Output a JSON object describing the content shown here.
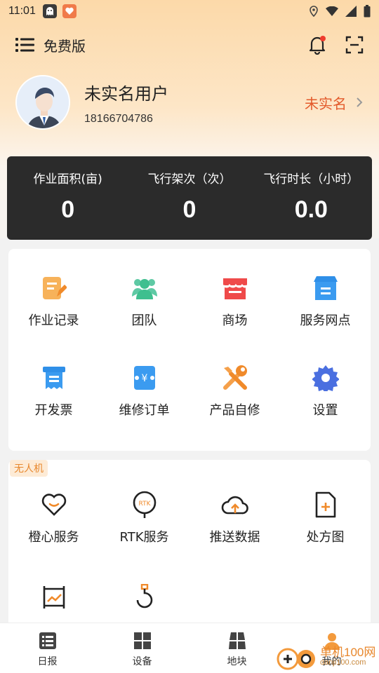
{
  "status_bar": {
    "time": "11:01",
    "icons": [
      "ghost-app-icon",
      "heart-app-icon",
      "location-icon",
      "wifi-icon",
      "signal-icon",
      "battery-icon"
    ]
  },
  "topbar": {
    "menu_icon": "list-icon",
    "edition": "免费版",
    "bell_icon": "bell-icon",
    "scan_icon": "scan-icon"
  },
  "profile": {
    "name": "未实名用户",
    "phone": "18166704786",
    "verify_label": "未实名"
  },
  "stats": [
    {
      "label": "作业面积(亩)",
      "value": "0"
    },
    {
      "label": "飞行架次（次）",
      "value": "0"
    },
    {
      "label": "飞行时长（小时）",
      "value": "0.0"
    }
  ],
  "services": [
    {
      "label": "作业记录",
      "icon": "note-edit-icon"
    },
    {
      "label": "团队",
      "icon": "team-icon"
    },
    {
      "label": "商场",
      "icon": "store-icon"
    },
    {
      "label": "服务网点",
      "icon": "service-point-icon"
    },
    {
      "label": "开发票",
      "icon": "invoice-icon"
    },
    {
      "label": "维修订单",
      "icon": "repair-order-icon"
    },
    {
      "label": "产品自修",
      "icon": "wrench-icon"
    },
    {
      "label": "设置",
      "icon": "gear-icon"
    }
  ],
  "drone": {
    "tag": "无人机",
    "items": [
      {
        "label": "橙心服务",
        "icon": "heart-smile-icon"
      },
      {
        "label": "RTK服务",
        "icon": "rtk-icon"
      },
      {
        "label": "推送数据",
        "icon": "cloud-upload-icon"
      },
      {
        "label": "处方图",
        "icon": "prescription-map-icon"
      },
      {
        "label": "",
        "icon": "chart-frame-icon"
      },
      {
        "label": "",
        "icon": "hook-icon"
      }
    ]
  },
  "tabbar": [
    {
      "label": "日报",
      "icon": "daily-report-icon"
    },
    {
      "label": "设备",
      "icon": "device-grid-icon"
    },
    {
      "label": "地块",
      "icon": "field-icon"
    },
    {
      "label": "我的",
      "icon": "person-icon"
    }
  ],
  "watermark": {
    "main": "单机100网",
    "sub": "danji100.com"
  },
  "colors": {
    "accent": "#e35a2b",
    "orange": "#f39a3c",
    "dark_panel": "#2b2b2b",
    "blue": "#2f8fe8",
    "green": "#3fbf8f",
    "red": "#ef4a4a"
  }
}
